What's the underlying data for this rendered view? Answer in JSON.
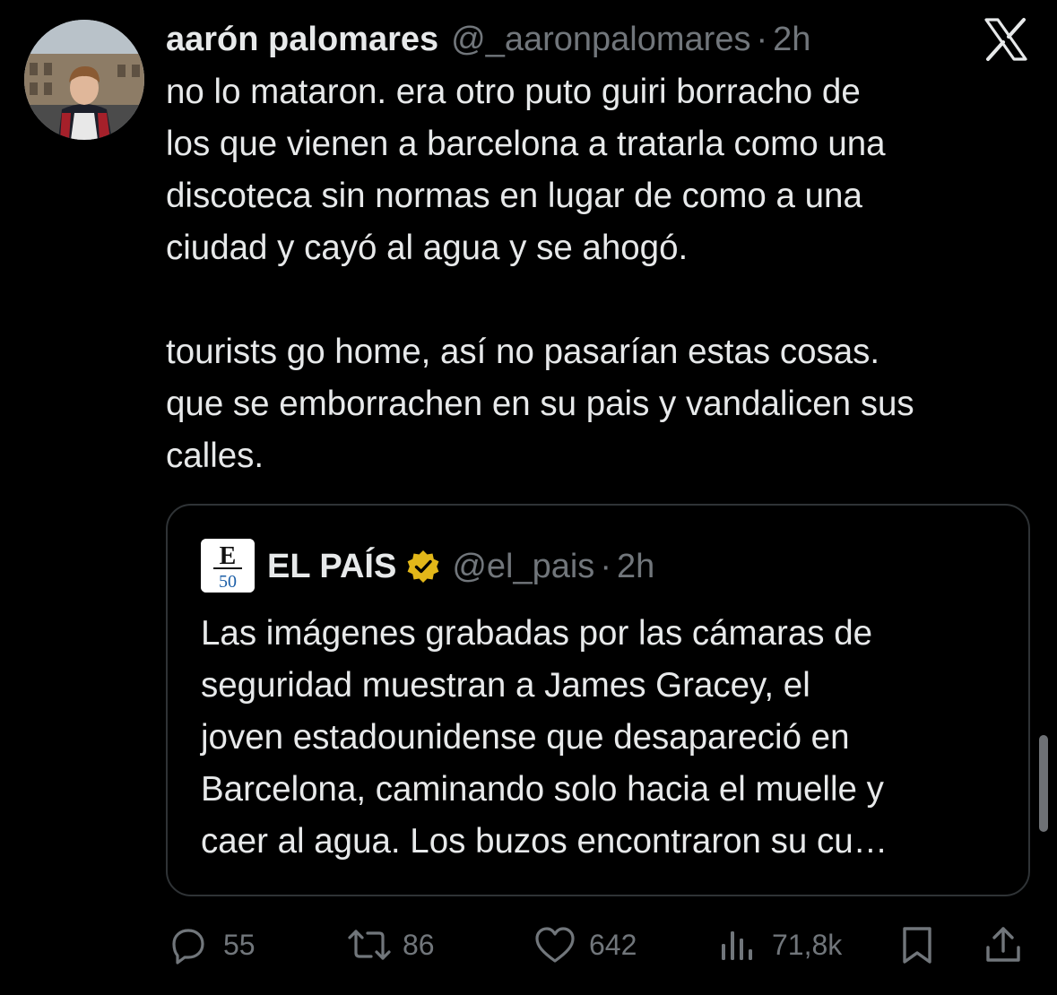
{
  "tweet": {
    "display_name": "aarón palomares",
    "handle": "@_aaronpalomares",
    "separator": "·",
    "time": "2h",
    "text": "no lo mataron. era otro puto guiri borracho de\nlos que vienen a barcelona a tratarla como una\ndiscoteca sin normas en lugar de como a una\nciudad y cayó al agua y se ahogó.\n\ntourists go home, así no pasarían estas cosas.\nque se emborrachen en su pais y vandalicen sus\ncalles."
  },
  "quote": {
    "name": "EL PAÍS",
    "handle": "@el_pais",
    "separator": "·",
    "time": "2h",
    "logo_letter": "E",
    "logo_number": "50",
    "text": "Las imágenes grabadas por las cámaras de\nseguridad muestran a James Gracey, el\njoven estadounidense que desapareció en\nBarcelona, caminando solo hacia el muelle y\ncaer al agua. Los buzos encontraron su cu…"
  },
  "actions": {
    "replies": "55",
    "reposts": "86",
    "likes": "642",
    "views": "71,8k"
  },
  "icons": {
    "brand": "x-logo-icon",
    "verified": "verified-gold-badge-icon",
    "reply": "reply-icon",
    "repost": "repost-icon",
    "like": "heart-icon",
    "views": "views-icon",
    "bookmark": "bookmark-icon",
    "share": "share-icon"
  },
  "colors": {
    "background": "#000000",
    "text": "#e7e9ea",
    "muted": "#71767b",
    "border": "#2f3336",
    "verified_gold": "#e2b719"
  }
}
